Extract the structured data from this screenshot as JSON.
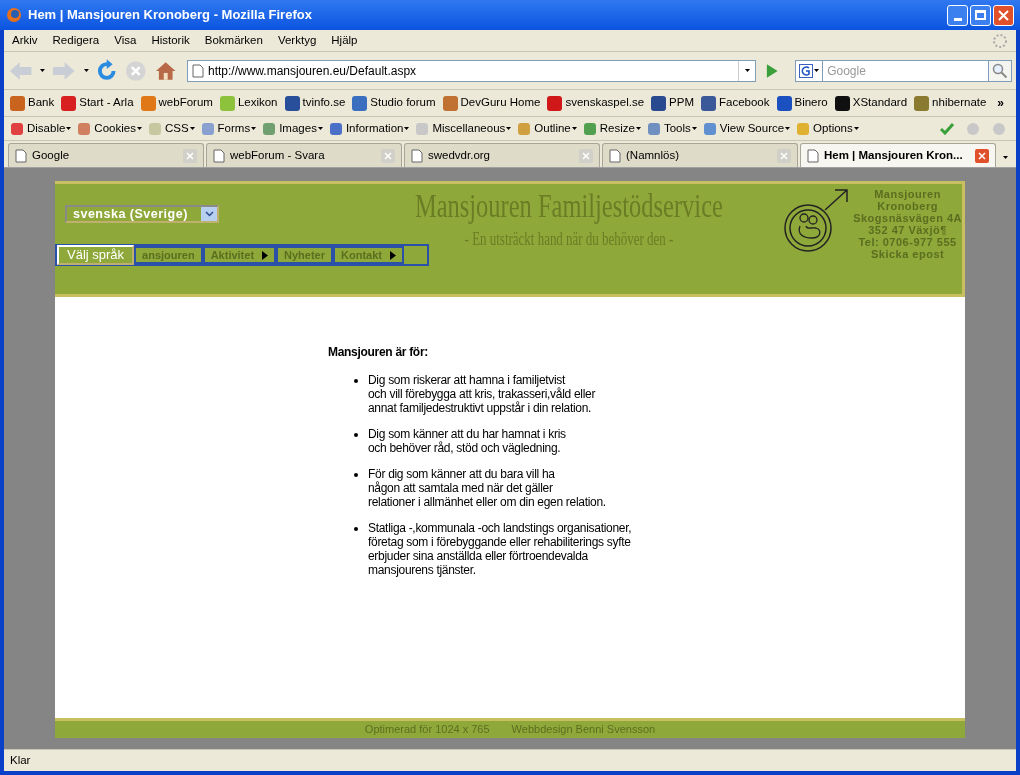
{
  "window": {
    "title": "Hem | Mansjouren Kronoberg - Mozilla Firefox"
  },
  "menu": [
    "Arkiv",
    "Redigera",
    "Visa",
    "Historik",
    "Bokmärken",
    "Verktyg",
    "Hjälp"
  ],
  "address": {
    "value": "http://www.mansjouren.eu/Default.aspx"
  },
  "search": {
    "placeholder": "Google"
  },
  "bookmarks": [
    {
      "label": "Bank",
      "color": "#c8641e"
    },
    {
      "label": "Start - Arla",
      "color": "#d82020"
    },
    {
      "label": "webForum",
      "color": "#e07818"
    },
    {
      "label": "Lexikon",
      "color": "#8cc23c"
    },
    {
      "label": "tvinfo.se",
      "color": "#2a4f9a"
    },
    {
      "label": "Studio forum",
      "color": "#3a6fc0"
    },
    {
      "label": "DevGuru Home",
      "color": "#c07030"
    },
    {
      "label": "svenskaspel.se",
      "color": "#d01818"
    },
    {
      "label": "PPM",
      "color": "#2a4a90"
    },
    {
      "label": "Facebook",
      "color": "#3b5998"
    },
    {
      "label": "Binero",
      "color": "#1a50c0"
    },
    {
      "label": "XStandard",
      "color": "#101010"
    },
    {
      "label": "nhibernate",
      "color": "#8a7a30"
    }
  ],
  "bookmarks_more": "»",
  "devtools": [
    "Disable",
    "Cookies",
    "CSS",
    "Forms",
    "Images",
    "Information",
    "Miscellaneous",
    "Outline",
    "Resize",
    "Tools",
    "View Source",
    "Options"
  ],
  "tabs": [
    {
      "label": "Google",
      "selected": false
    },
    {
      "label": "webForum - Svara",
      "selected": false
    },
    {
      "label": "swedvdr.org",
      "selected": false
    },
    {
      "label": "(Namnlös)",
      "selected": false
    },
    {
      "label": "Hem | Mansjouren Kron...",
      "selected": true
    }
  ],
  "page": {
    "language_select": {
      "value": "svenska (Sverige)"
    },
    "language_button": "Välj språk",
    "nav": [
      {
        "label": "ansjouren",
        "has_submenu": false
      },
      {
        "label": "Aktivitet",
        "has_submenu": true
      },
      {
        "label": "Nyheter",
        "has_submenu": false
      },
      {
        "label": "Kontakt",
        "has_submenu": true
      }
    ],
    "title": "Mansjouren Familjestödservice",
    "subtitle": "- En utsträckt hand när du behöver den -",
    "contact": [
      "Mansjouren",
      "Kronoberg",
      "Skogsnäsvägen 4A",
      "352 47 Växjö¶",
      "Tel: 0706-977 555",
      "Skicka epost"
    ],
    "heading": "Mansjouren är för:",
    "items": [
      [
        "Dig som riskerar att hamna i familjetvist",
        "och vill förebygga att kris, trakasseri,våld eller",
        "annat familjedestruktivt uppstår i din relation."
      ],
      [
        "Dig som känner att du har hamnat i kris",
        "och behöver råd, stöd och vägledning."
      ],
      [
        "För dig som känner att du bara vill ha",
        "någon att samtala med när det gäller",
        "relationer i allmänhet eller om din egen relation."
      ],
      [
        "Statliga -,kommunala -och landstings organisationer,",
        "företag som i förebyggande eller rehabiliterings syfte",
        "erbjuder sina anställda eller förtroendevalda",
        "mansjourens tjänster."
      ]
    ],
    "footer": [
      "Optimerad för 1024 x 765",
      "Webbdesign Benni Svensson"
    ]
  },
  "status_bar": "Klar"
}
